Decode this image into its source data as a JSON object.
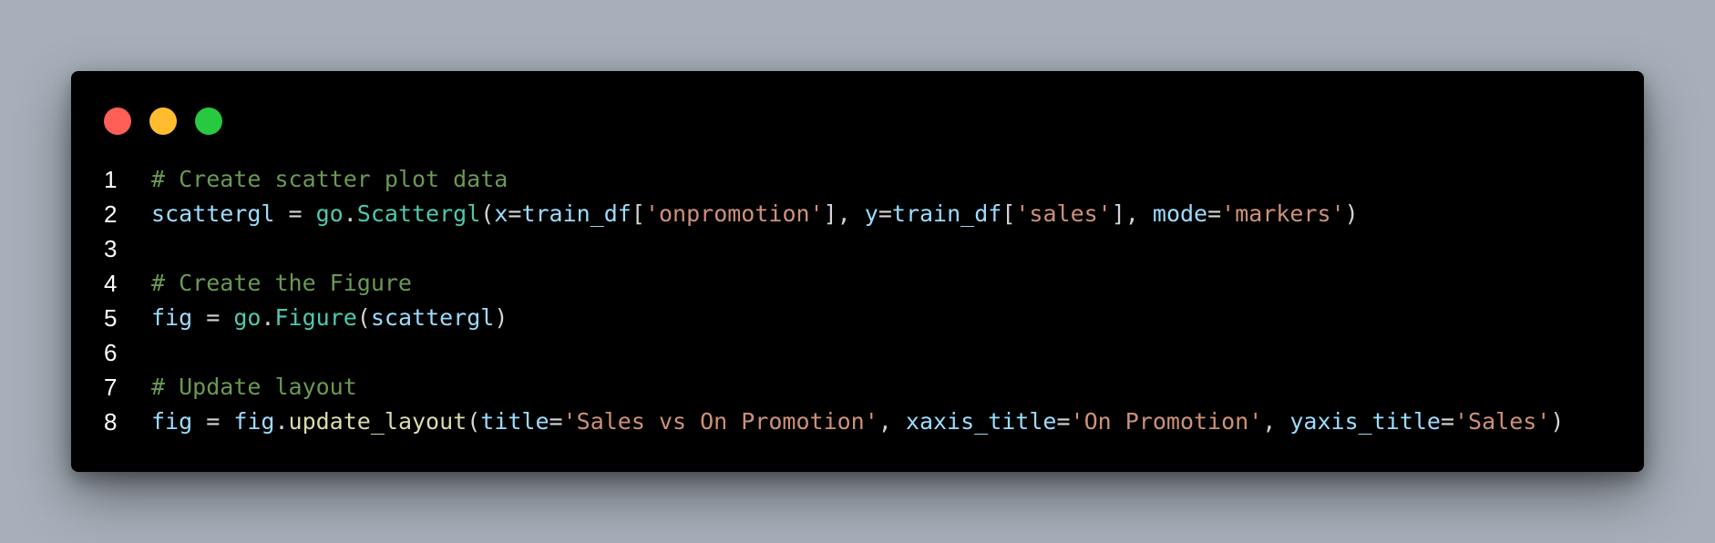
{
  "window": {
    "controls": {
      "close_color": "#ff5f57",
      "minimize_color": "#febc2e",
      "zoom_color": "#28c840"
    }
  },
  "colors": {
    "comment": "#6a9955",
    "variable": "#9cdcfe",
    "operator": "#d4d4d4",
    "module": "#4ec9b0",
    "function": "#dcdcaa",
    "string": "#ce9178",
    "line_number": "#ffffff"
  },
  "code_lines": [
    {
      "number": "1",
      "tokens": [
        {
          "text": "# Create scatter plot data",
          "kind": "comment"
        }
      ]
    },
    {
      "number": "2",
      "tokens": [
        {
          "text": "scattergl",
          "kind": "variable"
        },
        {
          "text": " = ",
          "kind": "operator"
        },
        {
          "text": "go",
          "kind": "module"
        },
        {
          "text": ".",
          "kind": "operator"
        },
        {
          "text": "Scattergl",
          "kind": "module"
        },
        {
          "text": "(",
          "kind": "operator"
        },
        {
          "text": "x",
          "kind": "variable"
        },
        {
          "text": "=",
          "kind": "operator"
        },
        {
          "text": "train_df",
          "kind": "variable"
        },
        {
          "text": "[",
          "kind": "operator"
        },
        {
          "text": "'onpromotion'",
          "kind": "string"
        },
        {
          "text": "], ",
          "kind": "operator"
        },
        {
          "text": "y",
          "kind": "variable"
        },
        {
          "text": "=",
          "kind": "operator"
        },
        {
          "text": "train_df",
          "kind": "variable"
        },
        {
          "text": "[",
          "kind": "operator"
        },
        {
          "text": "'sales'",
          "kind": "string"
        },
        {
          "text": "], ",
          "kind": "operator"
        },
        {
          "text": "mode",
          "kind": "variable"
        },
        {
          "text": "=",
          "kind": "operator"
        },
        {
          "text": "'markers'",
          "kind": "string"
        },
        {
          "text": ")",
          "kind": "operator"
        }
      ]
    },
    {
      "number": "3",
      "tokens": []
    },
    {
      "number": "4",
      "tokens": [
        {
          "text": "# Create the Figure",
          "kind": "comment"
        }
      ]
    },
    {
      "number": "5",
      "tokens": [
        {
          "text": "fig",
          "kind": "variable"
        },
        {
          "text": " = ",
          "kind": "operator"
        },
        {
          "text": "go",
          "kind": "module"
        },
        {
          "text": ".",
          "kind": "operator"
        },
        {
          "text": "Figure",
          "kind": "module"
        },
        {
          "text": "(",
          "kind": "operator"
        },
        {
          "text": "scattergl",
          "kind": "variable"
        },
        {
          "text": ")",
          "kind": "operator"
        }
      ]
    },
    {
      "number": "6",
      "tokens": []
    },
    {
      "number": "7",
      "tokens": [
        {
          "text": "# Update layout",
          "kind": "comment"
        }
      ]
    },
    {
      "number": "8",
      "tokens": [
        {
          "text": "fig",
          "kind": "variable"
        },
        {
          "text": " = ",
          "kind": "operator"
        },
        {
          "text": "fig",
          "kind": "variable"
        },
        {
          "text": ".",
          "kind": "operator"
        },
        {
          "text": "update_layout",
          "kind": "function"
        },
        {
          "text": "(",
          "kind": "operator"
        },
        {
          "text": "title",
          "kind": "variable"
        },
        {
          "text": "=",
          "kind": "operator"
        },
        {
          "text": "'Sales vs On Promotion'",
          "kind": "string"
        },
        {
          "text": ", ",
          "kind": "operator"
        },
        {
          "text": "xaxis_title",
          "kind": "variable"
        },
        {
          "text": "=",
          "kind": "operator"
        },
        {
          "text": "'On Promotion'",
          "kind": "string"
        },
        {
          "text": ", ",
          "kind": "operator"
        },
        {
          "text": "yaxis_title",
          "kind": "variable"
        },
        {
          "text": "=",
          "kind": "operator"
        },
        {
          "text": "'Sales'",
          "kind": "string"
        },
        {
          "text": ")",
          "kind": "operator"
        }
      ]
    }
  ]
}
